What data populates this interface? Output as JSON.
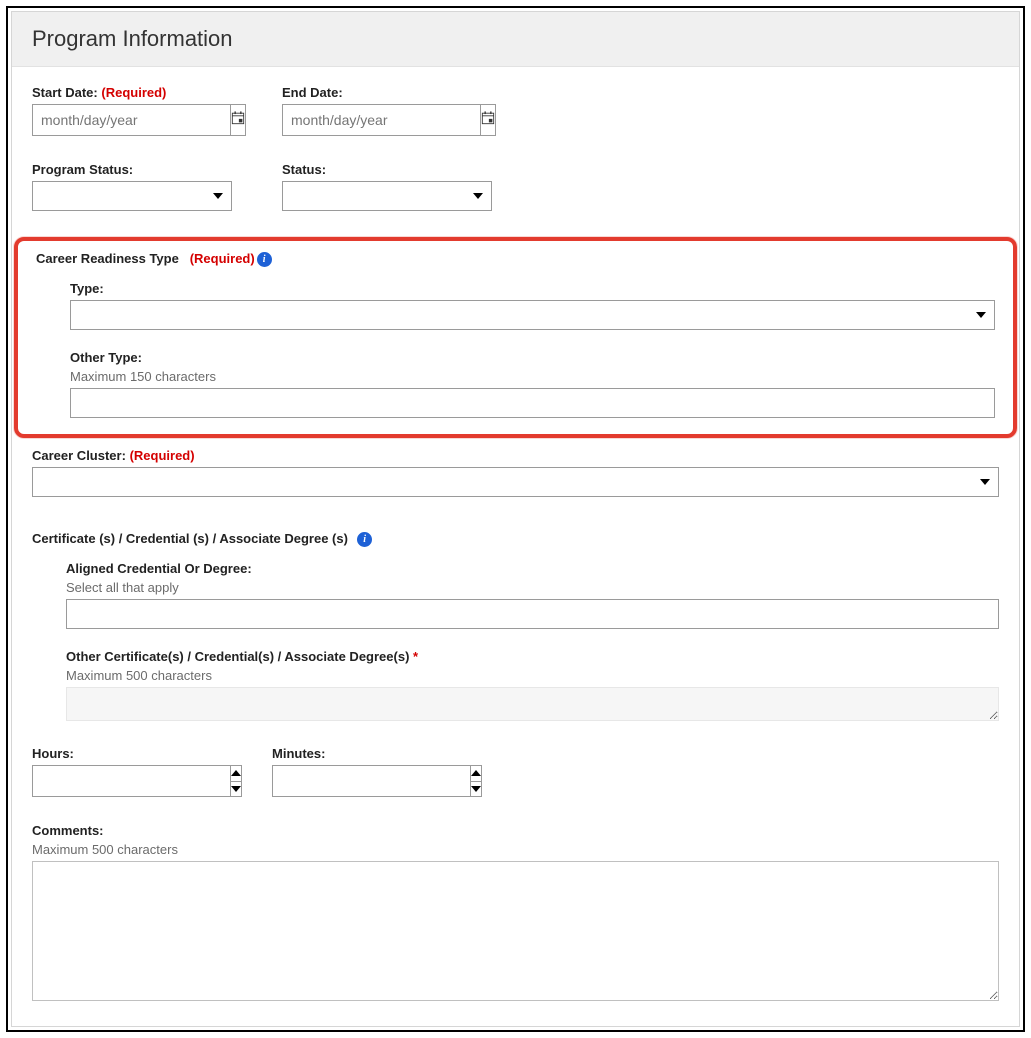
{
  "header": {
    "title": "Program Information"
  },
  "startDate": {
    "label": "Start Date:",
    "required": "(Required)",
    "placeholder": "month/day/year"
  },
  "endDate": {
    "label": "End Date:",
    "placeholder": "month/day/year"
  },
  "programStatus": {
    "label": "Program Status:"
  },
  "status": {
    "label": "Status:"
  },
  "careerReadiness": {
    "section": "Career Readiness Type",
    "required": "(Required)",
    "typeLabel": "Type:",
    "otherTypeLabel": "Other Type:",
    "otherHelper": "Maximum 150 characters"
  },
  "careerCluster": {
    "label": "Career Cluster:",
    "required": "(Required)"
  },
  "certificates": {
    "section": "Certificate (s) / Credential (s) / Associate Degree (s)",
    "alignedLabel": "Aligned Credential Or Degree:",
    "alignedHelper": "Select all that apply",
    "otherLabel": "Other Certificate(s) / Credential(s) / Associate Degree(s)",
    "asterisk": "*",
    "otherHelper": "Maximum 500 characters"
  },
  "hours": {
    "label": "Hours:"
  },
  "minutes": {
    "label": "Minutes:"
  },
  "comments": {
    "label": "Comments:",
    "helper": "Maximum 500 characters"
  }
}
